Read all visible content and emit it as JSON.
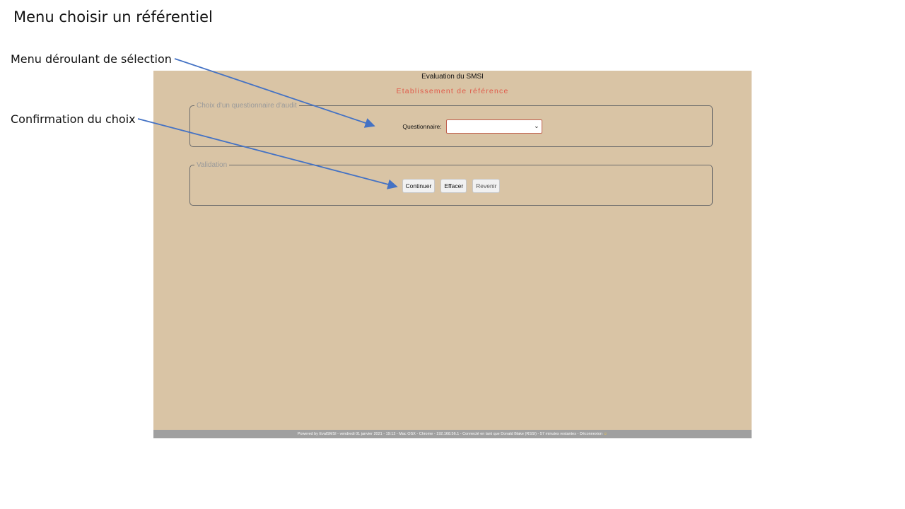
{
  "slide": {
    "title": "Menu choisir un référentiel",
    "annotations": {
      "select_menu": "Menu déroulant de sélection",
      "confirm_choice": "Confirmation du choix"
    }
  },
  "app": {
    "title": "Evaluation du SMSI",
    "subtitle": "Etablissement de référence",
    "questionnaire_fieldset": {
      "legend": "Choix d'un questionnaire d'audit",
      "field_label": "Questionnaire:",
      "select_value": ""
    },
    "validation_fieldset": {
      "legend": "Validation",
      "buttons": {
        "continue": "Continuer",
        "clear": "Effacer",
        "back": "Revenir"
      }
    },
    "footer": {
      "text": "Powered by EvalSMSI - vendredi 01 janvier 2021 - 19:12 - Mac OSX - Chrome - 192.168.56.1 - Connecté en tant que Donald Blake (RSSI) - 57 minutes restantes - Déconnexion",
      "icon": "smiley-icon"
    }
  },
  "colors": {
    "app_background": "#d9c4a5",
    "subtitle": "#e05a4a",
    "arrow": "#4472c4",
    "footer": "#a0a0a0"
  }
}
